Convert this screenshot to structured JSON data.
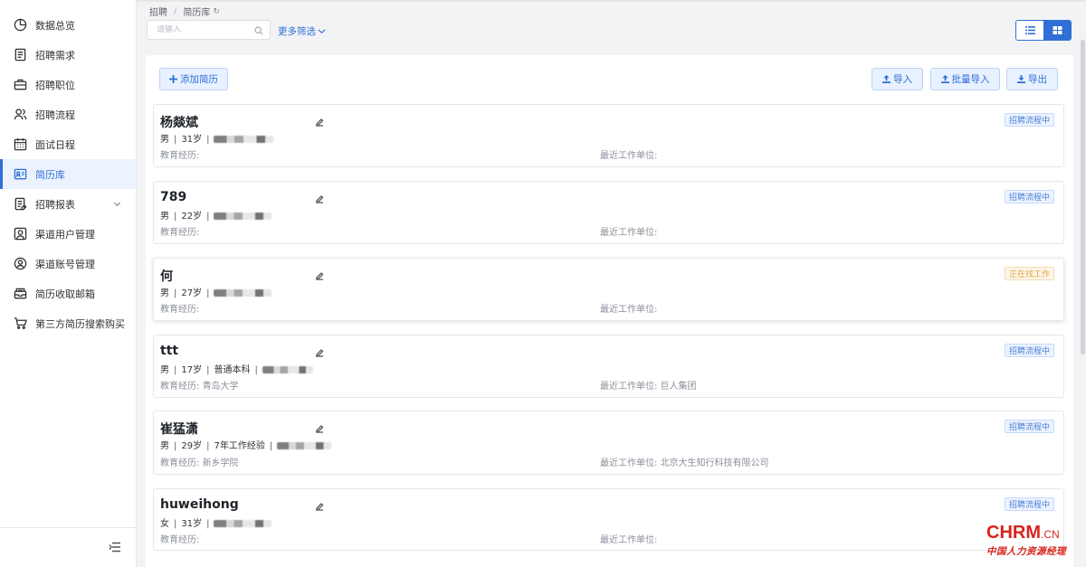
{
  "sidebar": {
    "items": [
      {
        "label": "数据总览",
        "icon": "pie-chart-icon",
        "active": false
      },
      {
        "label": "招聘需求",
        "icon": "document-list-icon",
        "active": false
      },
      {
        "label": "招聘职位",
        "icon": "briefcase-icon",
        "active": false
      },
      {
        "label": "招聘流程",
        "icon": "users-icon",
        "active": false
      },
      {
        "label": "面试日程",
        "icon": "calendar-icon",
        "active": false
      },
      {
        "label": "简历库",
        "icon": "id-card-icon",
        "active": true
      },
      {
        "label": "招聘报表",
        "icon": "report-icon",
        "active": false,
        "expandable": true
      },
      {
        "label": "渠道用户管理",
        "icon": "user-frame-icon",
        "active": false
      },
      {
        "label": "渠道账号管理",
        "icon": "user-circle-icon",
        "active": false
      },
      {
        "label": "简历收取邮箱",
        "icon": "mailbox-icon",
        "active": false
      },
      {
        "label": "第三方简历搜索购买",
        "icon": "cart-icon",
        "active": false
      }
    ]
  },
  "breadcrumb": {
    "root": "招聘",
    "sep": "/",
    "current": "简历库"
  },
  "search": {
    "placeholder": "请输入",
    "value": ""
  },
  "filters": {
    "more_label": "更多筛选"
  },
  "toolbar": {
    "add_label": "添加简历",
    "import_label": "导入",
    "batch_import_label": "批量导入",
    "export_label": "导出"
  },
  "labels": {
    "education": "教育经历:",
    "recent_employer": "最近工作单位:"
  },
  "resumes": [
    {
      "name": "杨燚斌",
      "gender": "男",
      "age": "31岁",
      "extra": "",
      "school": "",
      "employer": "",
      "status": "招聘流程中",
      "status_color": "#4a7fd4"
    },
    {
      "name": "789",
      "gender": "男",
      "age": "22岁",
      "extra": "",
      "school": "",
      "employer": "",
      "status": "招聘流程中",
      "status_color": "#4a7fd4"
    },
    {
      "name": "何",
      "gender": "男",
      "age": "27岁",
      "extra": "",
      "school": "",
      "employer": "",
      "status": "正在找工作",
      "status_color": "#e6a23c"
    },
    {
      "name": "ttt",
      "gender": "男",
      "age": "17岁",
      "extra": "普通本科",
      "school": "青岛大学",
      "employer": "巨人集团",
      "status": "招聘流程中",
      "status_color": "#4a7fd4"
    },
    {
      "name": "崔猛潇",
      "gender": "男",
      "age": "29岁",
      "extra": "7年工作经验",
      "school": "新乡学院",
      "employer": "北京大生知行科技有限公司",
      "status": "招聘流程中",
      "status_color": "#4a7fd4"
    },
    {
      "name": "huweihong",
      "gender": "女",
      "age": "31岁",
      "extra": "",
      "school": "",
      "employer": "",
      "status": "招聘流程中",
      "status_color": "#4a7fd4"
    }
  ],
  "watermark": {
    "brand": "CHRM",
    "domain": ".CN",
    "slogan": "中国人力资源经理"
  },
  "colors": {
    "accent": "#2f6fd6",
    "status_blue": "#4a7fd4",
    "status_orange": "#e6a23c",
    "brand_red": "#d8231d"
  }
}
